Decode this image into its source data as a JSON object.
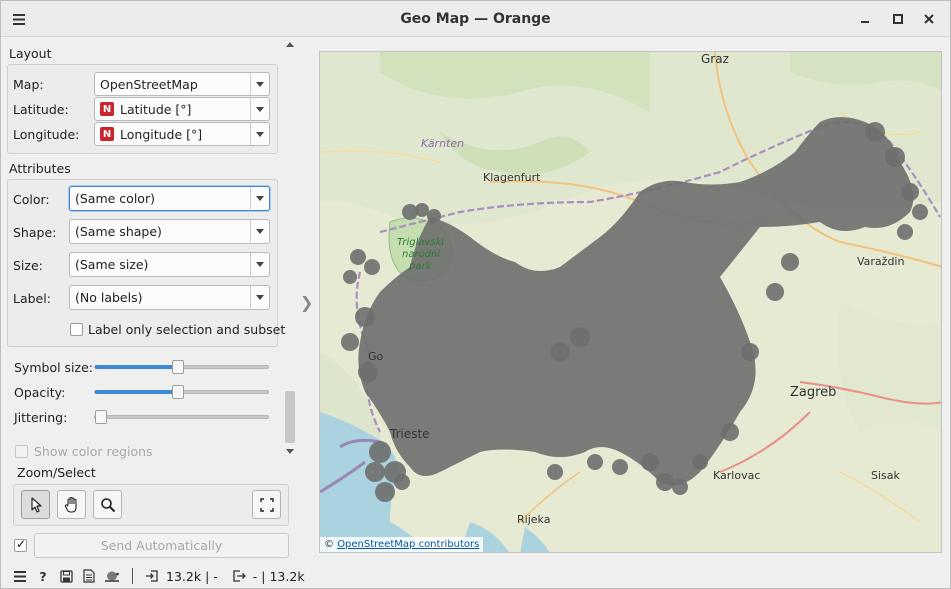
{
  "window": {
    "title": "Geo Map — Orange"
  },
  "layout": {
    "heading": "Layout",
    "map_label": "Map:",
    "map_value": "OpenStreetMap",
    "latitude_label": "Latitude:",
    "latitude_value": "Latitude [°]",
    "longitude_label": "Longitude:",
    "longitude_value": "Longitude [°]",
    "var_type_badge": "N"
  },
  "attributes": {
    "heading": "Attributes",
    "color_label": "Color:",
    "color_value": "(Same color)",
    "shape_label": "Shape:",
    "shape_value": "(Same shape)",
    "size_label": "Size:",
    "size_value": "(Same size)",
    "label_label": "Label:",
    "label_value": "(No labels)",
    "label_only_selection": "Label only selection and subset",
    "label_only_selection_checked": false
  },
  "sliders": {
    "symbol_size_label": "Symbol size:",
    "symbol_size_level": 0.5,
    "opacity_label": "Opacity:",
    "opacity_level": 0.5,
    "jittering_label": "Jittering:",
    "jittering_level": 0.0
  },
  "show_color_regions": {
    "label": "Show color regions",
    "checked": false,
    "enabled": false
  },
  "zoom_select": {
    "heading": "Zoom/Select",
    "tools": [
      "pointer-icon",
      "hand-icon",
      "magnifier-icon"
    ],
    "fit_icon": "fullscreen-icon"
  },
  "send": {
    "label": "Send Automatically",
    "auto_checked": true
  },
  "map": {
    "attribution_prefix": "©",
    "attribution_link": "OpenStreetMap contributors",
    "place_labels": {
      "graz": "Graz",
      "karnten": "Kärnten",
      "klagenfurt": "Klagenfurt",
      "triglav1": "Triglavski",
      "triglav2": "narodni",
      "triglav3": "park",
      "varazdin": "Varaždin",
      "zagreb": "Zagreb",
      "trieste": "Trieste",
      "karlovac": "Karlovac",
      "rijeka": "Rijeka",
      "sisak": "Sisak",
      "go": "Go"
    },
    "point_color": "#6e6e6e"
  },
  "status": {
    "input_count": "13.2k",
    "input_suffix": "| -",
    "output_prefix": "-",
    "output_count": "| 13.2k"
  }
}
